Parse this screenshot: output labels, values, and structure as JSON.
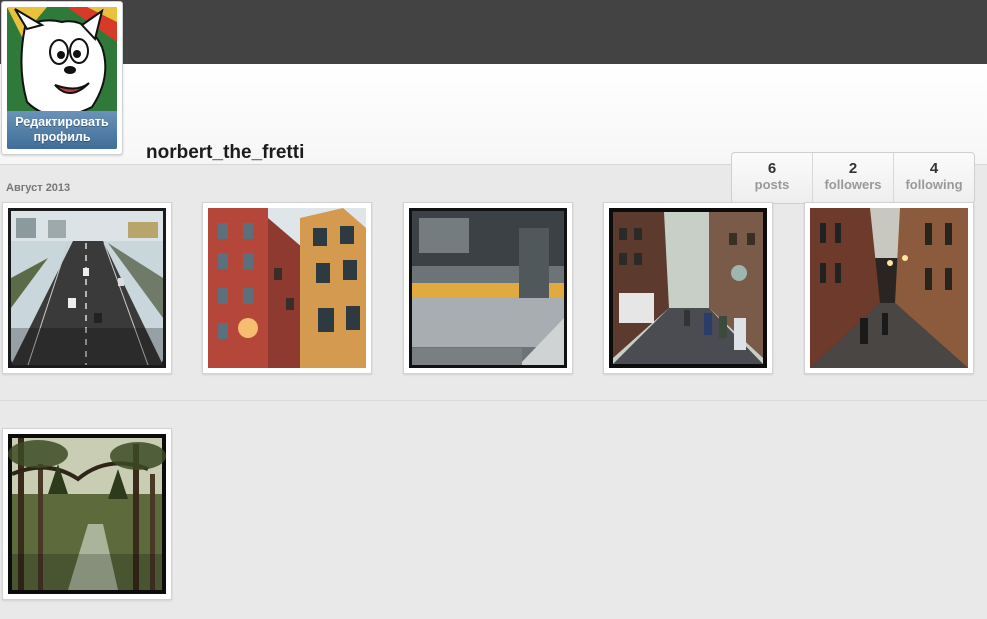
{
  "profile": {
    "username": "norbert_the_fretti",
    "edit_button_line1": "Редактировать",
    "edit_button_line2": "профиль"
  },
  "stats": [
    {
      "value": "6",
      "label": "posts"
    },
    {
      "value": "2",
      "label": "followers"
    },
    {
      "value": "4",
      "label": "following"
    }
  ],
  "feed": {
    "month_label": "Август 2013",
    "photos": [
      {
        "subject": "highway"
      },
      {
        "subject": "colorful-buildings"
      },
      {
        "subject": "moving-train"
      },
      {
        "subject": "city-street-crowd"
      },
      {
        "subject": "narrow-old-street"
      },
      {
        "subject": "forest-river"
      }
    ]
  },
  "colors": {
    "topbar": "#434343",
    "edit_button": "#4f7ea8",
    "background": "#e9e9e9"
  }
}
